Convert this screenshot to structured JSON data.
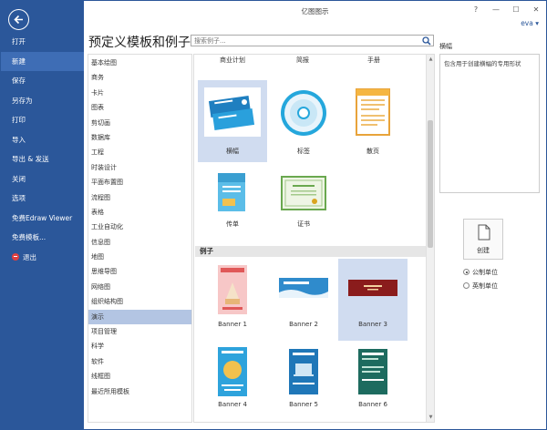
{
  "window": {
    "title": "亿图图示",
    "user": "eva ▾",
    "accent": "#2b579a"
  },
  "nav": {
    "items": [
      {
        "label": "打开"
      },
      {
        "label": "新建"
      },
      {
        "label": "保存"
      },
      {
        "label": "另存为"
      },
      {
        "label": "打印"
      },
      {
        "label": "导入"
      },
      {
        "label": "导出 & 发送"
      },
      {
        "label": "关闭"
      },
      {
        "label": "选项"
      },
      {
        "label": "免费Edraw Viewer"
      },
      {
        "label": "免费模板..."
      },
      {
        "label": "退出"
      }
    ],
    "active": "新建"
  },
  "page": {
    "title": "预定义模板和例子"
  },
  "search": {
    "placeholder": "搜索例子..."
  },
  "categories": [
    "基本绘图",
    "商务",
    "卡片",
    "图表",
    "剪切画",
    "数据库",
    "工程",
    "时装设计",
    "平面布置图",
    "流程图",
    "表格",
    "工业自动化",
    "信息图",
    "地图",
    "思维导图",
    "网络图",
    "组织结构图",
    "演示",
    "项目管理",
    "科学",
    "软件",
    "线框图",
    "最近所用模板"
  ],
  "active_category": "演示",
  "top_categories": [
    "商业计划",
    "简报",
    "手册"
  ],
  "templates": [
    {
      "label": "横幅",
      "icon": "banner-icon"
    },
    {
      "label": "标签",
      "icon": "label-disc-icon"
    },
    {
      "label": "散页",
      "icon": "flyer-icon"
    },
    {
      "label": "传单",
      "icon": "leaflet-icon"
    },
    {
      "label": "证书",
      "icon": "certificate-icon"
    }
  ],
  "examples_header": "例子",
  "examples": [
    {
      "label": "Banner 1"
    },
    {
      "label": "Banner 2"
    },
    {
      "label": "Banner 3"
    },
    {
      "label": "Banner 4"
    },
    {
      "label": "Banner 5"
    },
    {
      "label": "Banner 6"
    }
  ],
  "right": {
    "title": "横幅",
    "description": "包含用于创建横幅的专用形状",
    "create_label": "创建",
    "units": [
      {
        "label": "公制单位",
        "selected": true
      },
      {
        "label": "英制单位",
        "selected": false
      }
    ]
  }
}
